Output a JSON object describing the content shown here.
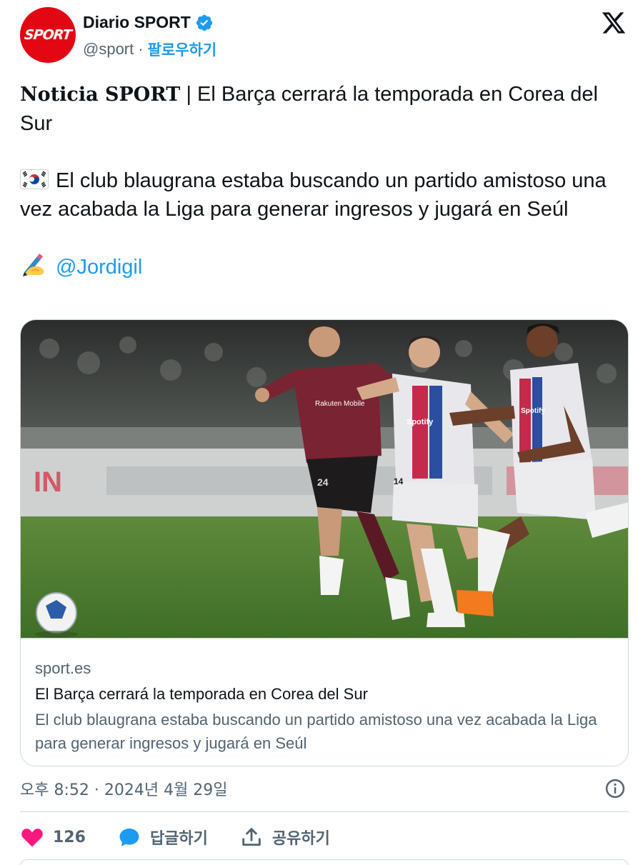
{
  "author": {
    "display_name": "Diario SPORT",
    "avatar_text": "SPORT",
    "handle": "@sport",
    "separator": "·",
    "follow_label": "팔로우하기"
  },
  "tweet": {
    "lead_bold": "Noticia SPORT",
    "lead_rest": " | El Barça cerrará la temporada en Corea del Sur",
    "paragraph2": "El club blaugrana estaba buscando un partido amistoso una vez acabada la Liga para generar ingresos y jugará en Seúl",
    "mention": "@Jordigil"
  },
  "card": {
    "domain": "sport.es",
    "title": "El Barça cerrará la temporada en Corea del Sur",
    "description": "El club blaugrana estaba buscando un partido amistoso una vez acabada la Liga para generar ingresos y jugará en Seúl",
    "image_text": {
      "sponsor_rakuten": "Rakuten Mobile",
      "sponsor_spotify": "Spotify",
      "number_a": "24",
      "number_b": "14"
    }
  },
  "timestamp": "오후 8:52 · 2024년 4월 29일",
  "actions": {
    "like_count": "126",
    "reply_label": "답글하기",
    "share_label": "공유하기"
  },
  "colors": {
    "accent": "#1d9bf0",
    "like": "#f91880",
    "brand_red": "#e30613",
    "text": "#0f1419",
    "muted": "#536471"
  },
  "icons": [
    "verified-badge-icon",
    "x-logo-icon",
    "korea-flag-icon",
    "writing-hand-icon",
    "info-icon",
    "heart-icon",
    "reply-bubble-icon",
    "share-icon"
  ]
}
